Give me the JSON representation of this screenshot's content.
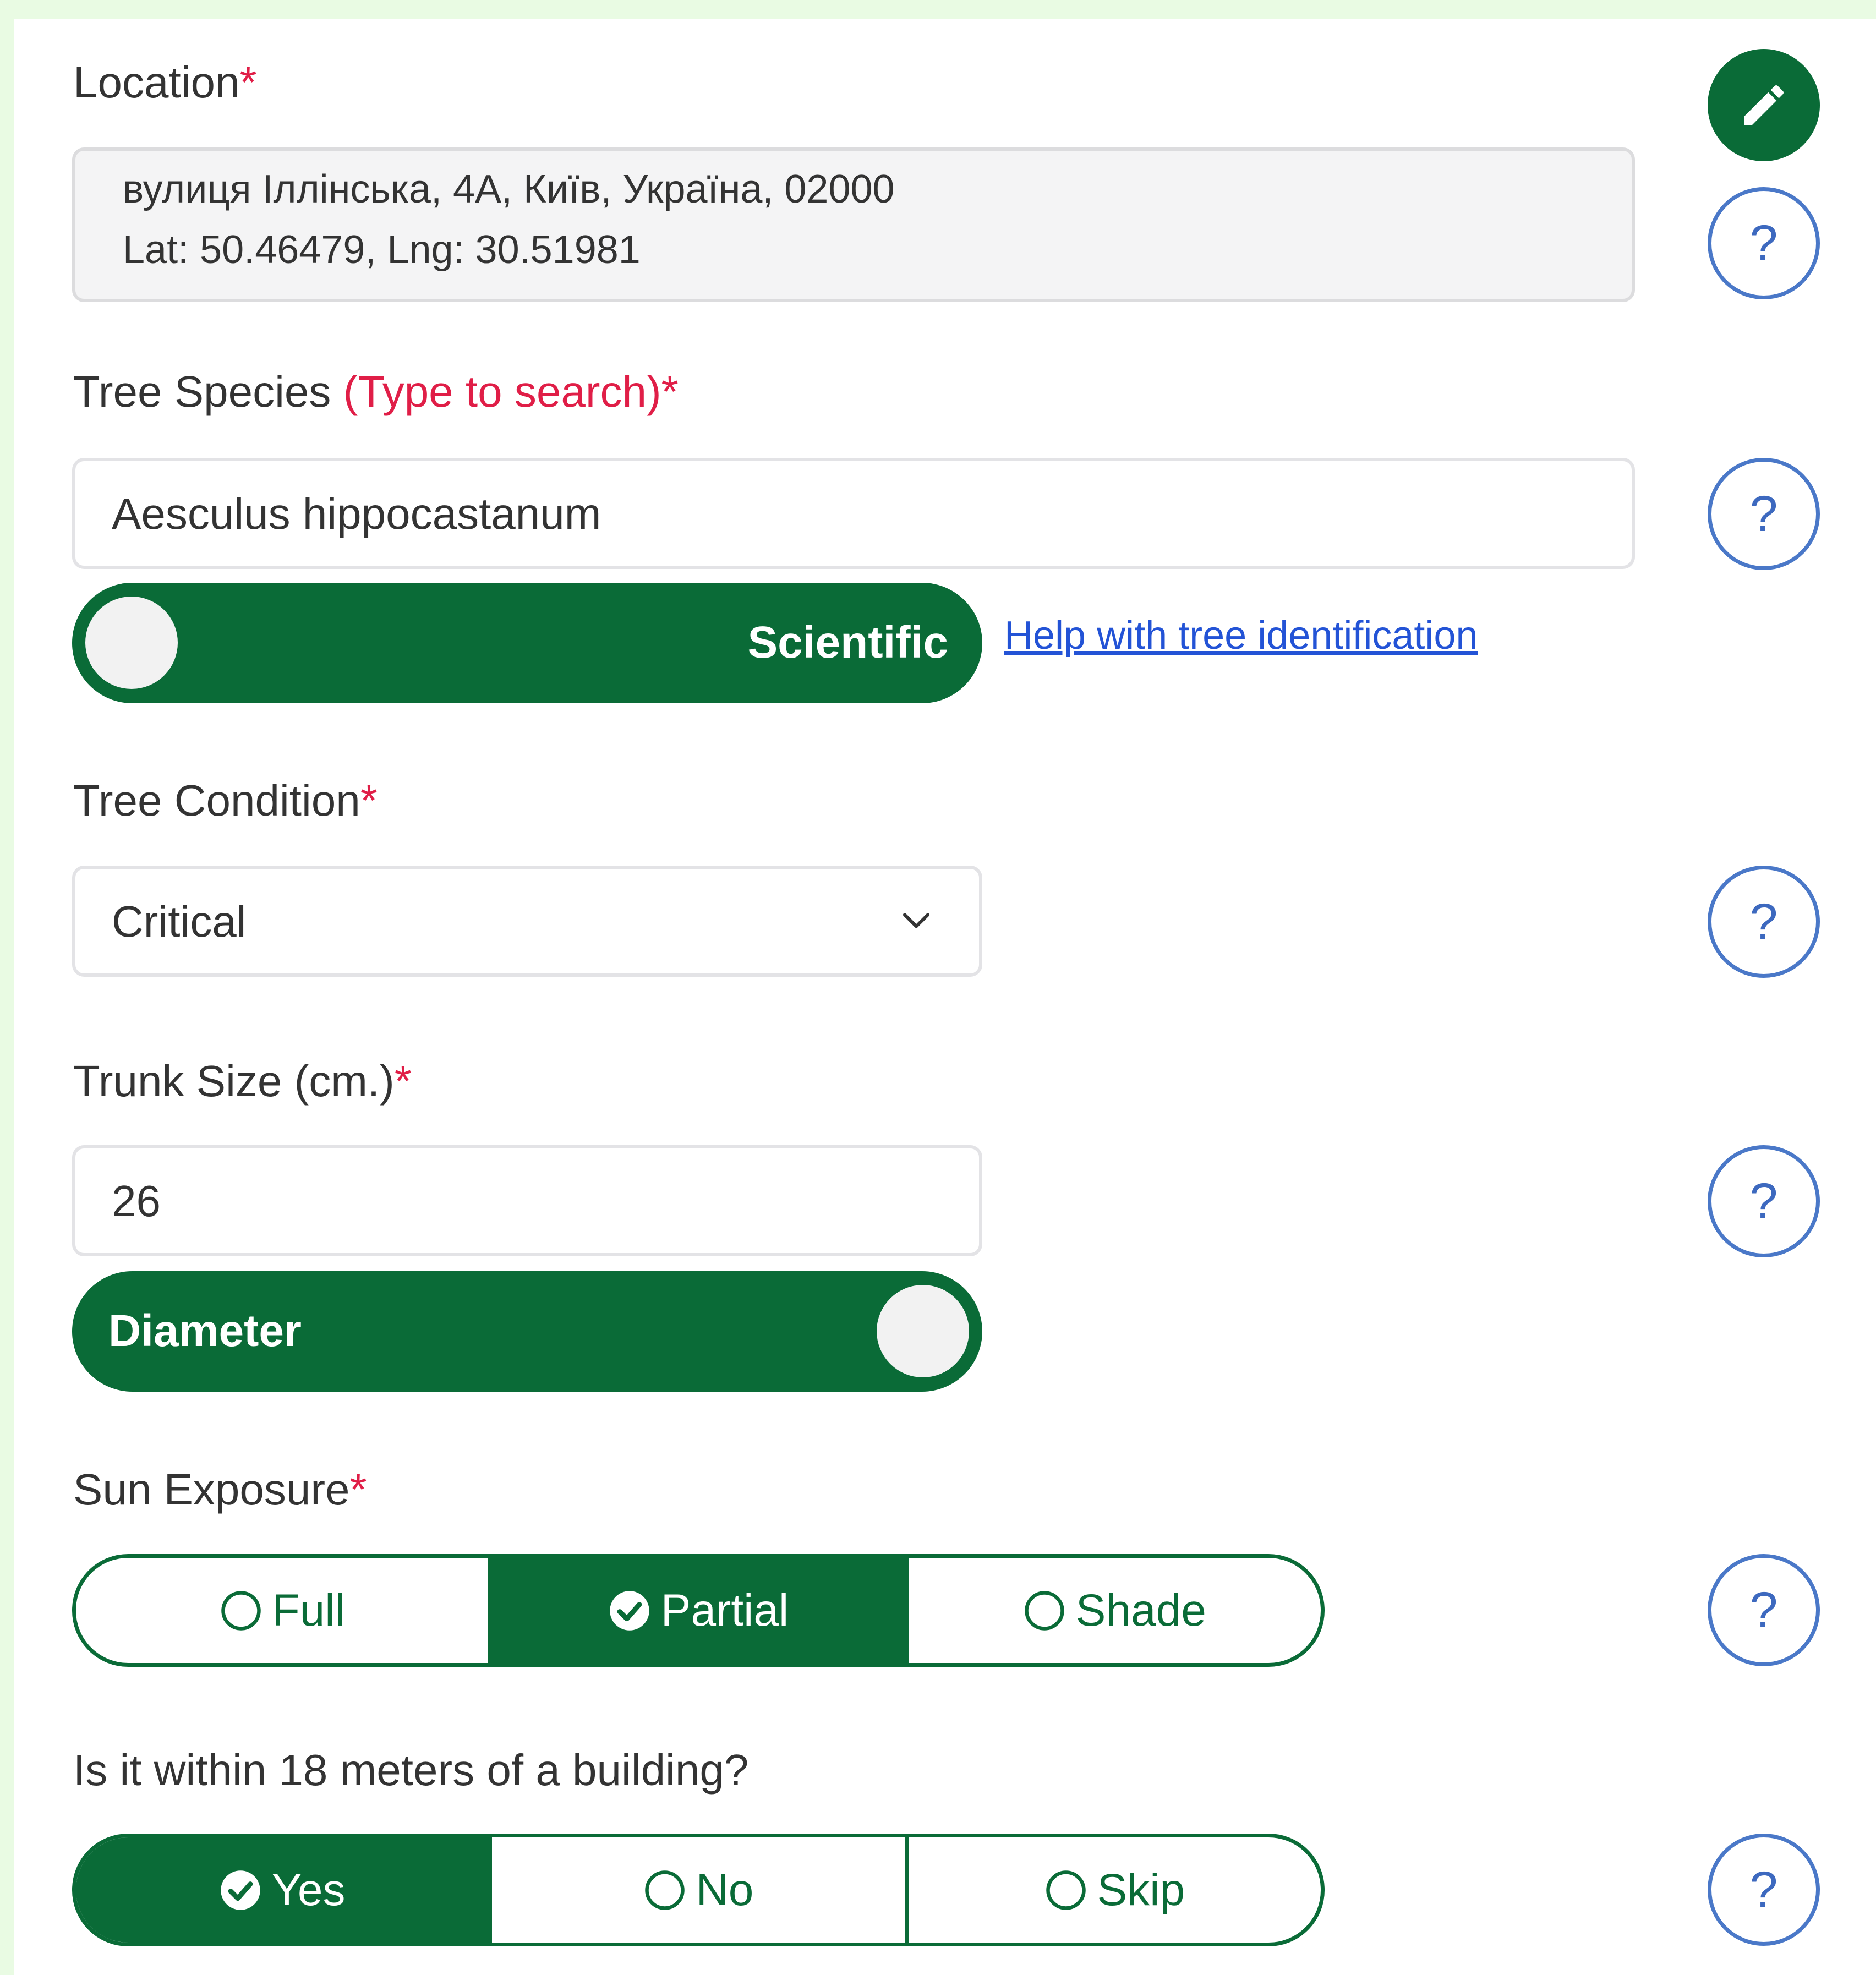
{
  "colors": {
    "brand_green": "#0a6b37",
    "required_red": "#e01e47",
    "help_blue": "#4a78c8",
    "link_blue": "#2353d6",
    "page_background": "#e9fbe3"
  },
  "location": {
    "label": "Location",
    "required_mark": "*",
    "address": "вулиця Іллінська, 4А, Київ, Україна, 02000",
    "coordinates": "Lat: 50.46479, Lng: 30.51981",
    "edit_icon": "pencil-icon",
    "help_label": "?"
  },
  "species": {
    "label": "Tree Species",
    "hint": "(Type to search)",
    "required_mark": "*",
    "value": "Aesculus hippocastanum",
    "toggle_label": "Scientific",
    "help_link": "Help with tree identification",
    "help_label": "?"
  },
  "condition": {
    "label": "Tree Condition",
    "required_mark": "*",
    "selected": "Critical",
    "help_label": "?"
  },
  "trunk": {
    "label": "Trunk Size (cm.)",
    "required_mark": "*",
    "value": "26",
    "toggle_label": "Diameter",
    "help_label": "?"
  },
  "sun": {
    "label": "Sun Exposure",
    "required_mark": "*",
    "options": [
      "Full",
      "Partial",
      "Shade"
    ],
    "selected": "Partial",
    "help_label": "?"
  },
  "building": {
    "label": "Is it within 18 meters of a building?",
    "options": [
      "Yes",
      "No",
      "Skip"
    ],
    "selected": "Yes",
    "help_label": "?"
  }
}
